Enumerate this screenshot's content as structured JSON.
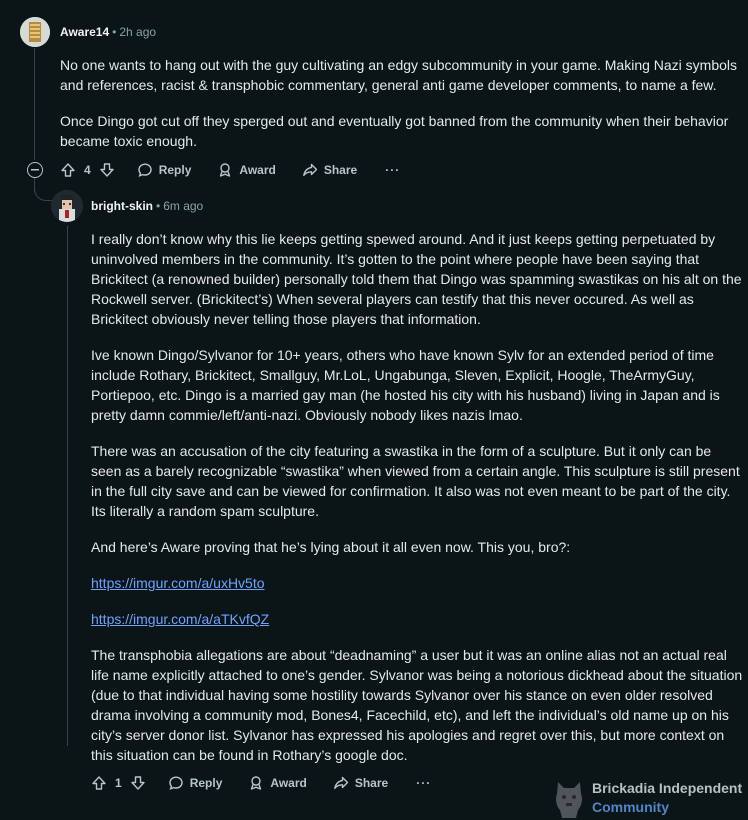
{
  "comment1": {
    "username": "Aware14",
    "time": "2h ago",
    "paragraphs": [
      "No one wants to hang out with the guy cultivating an edgy subcommunity in your game. Making Nazi symbols and references, racist & transphobic commentary, general anti game developer comments, to name a few.",
      "Once Dingo got cut off they sperged out and eventually got banned from the community when their behavior became toxic enough."
    ],
    "votes": "4",
    "reply": "Reply",
    "award": "Award",
    "share": "Share",
    "more": "···"
  },
  "comment2": {
    "username": "bright-skin",
    "time": "6m ago",
    "paragraphs": [
      "I really don’t know why this lie keeps getting spewed around. And it just keeps getting perpetuated by uninvolved members in the community. It’s gotten to the point where people have been saying that Brickitect (a renowned builder) personally told them that Dingo was spamming swastikas on his alt on the Rockwell server. (Brickitect’s) When several players can testify that this never occured. As well as Brickitect obviously never telling those players that information.",
      "Ive known Dingo/Sylvanor for 10+ years, others who have known Sylv for an extended period of time include Rothary, Brickitect, Smallguy, Mr.LoL, Ungabunga, Sleven, Explicit, Hoogle, TheArmyGuy, Portiepoo, etc. Dingo is a married gay man (he hosted his city with his husband) living in Japan and is pretty damn commie/left/anti-nazi. Obviously nobody likes nazis lmao.",
      "There was an accusation of the city featuring a swastika in the form of a sculpture. But it only can be seen as a barely recognizable “swastika” when viewed from a certain angle. This sculpture is still present in the full city save and can be viewed for confirmation. It also was not even meant to be part of the city. Its literally a random spam sculpture.",
      "And here’s Aware proving that he’s lying about it all even now. This you, bro?:"
    ],
    "link1": "https://imgur.com/a/uxHv5to",
    "link2": "https://imgur.com/a/aTKvfQZ",
    "paragraph5": "The transphobia allegations are about “deadnaming” a user but it was an online alias not an actual real life name explicitly attached to one’s gender. Sylvanor was being a notorious dickhead about the situation (due to that individual having some hostility towards Sylvanor over his stance on even older resolved drama involving a community mod, Bones4, Facechild, etc), and left the individual’s old name up on his city’s server donor list. Sylvanor has expressed his apologies and regret over this, but more context on this situation can be found in Rothary’s google doc.",
    "votes": "1",
    "reply": "Reply",
    "award": "Award",
    "share": "Share",
    "more": "···"
  },
  "watermark": {
    "line1": "Brickadia Independent",
    "line2": "Community"
  },
  "colors": {
    "background": "#0b1416",
    "link": "#6ea3ff",
    "meta": "#8ba2ad",
    "watermark_accent": "#5a9ae8"
  }
}
